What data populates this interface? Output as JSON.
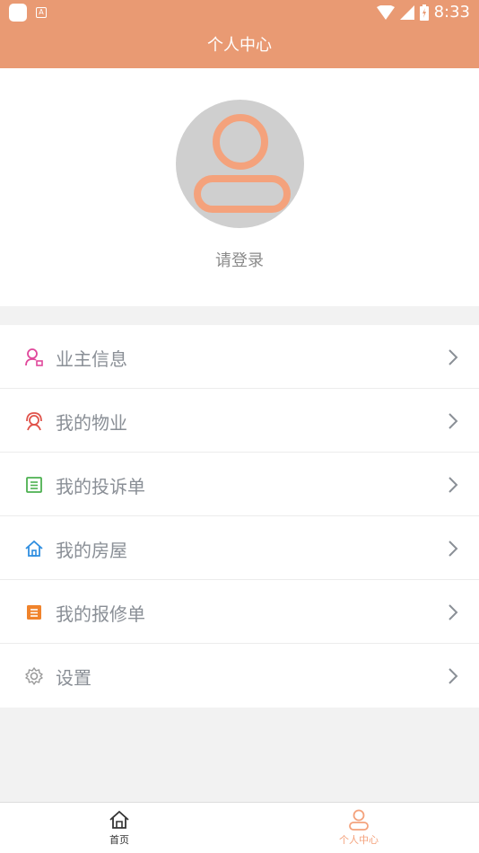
{
  "status_bar": {
    "time": "8:33"
  },
  "header": {
    "title": "个人中心"
  },
  "profile": {
    "login_text": "请登录"
  },
  "menu": {
    "items": [
      {
        "label": "业主信息",
        "icon": "owner-info-icon",
        "color": "#e0479b"
      },
      {
        "label": "我的物业",
        "icon": "property-service-icon",
        "color": "#e0524a"
      },
      {
        "label": "我的投诉单",
        "icon": "complaint-form-icon",
        "color": "#4cb050"
      },
      {
        "label": "我的房屋",
        "icon": "house-icon",
        "color": "#2f8ee0"
      },
      {
        "label": "我的报修单",
        "icon": "repair-form-icon",
        "color": "#f0832c"
      },
      {
        "label": "设置",
        "icon": "gear-icon",
        "color": "#9a9a9a"
      }
    ]
  },
  "tabbar": {
    "tabs": [
      {
        "label": "首页",
        "icon": "home-icon",
        "active": false
      },
      {
        "label": "个人中心",
        "icon": "person-icon",
        "active": true
      }
    ]
  },
  "colors": {
    "accent": "#e99a73",
    "tab_active": "#f4a27c",
    "tab_inactive": "#333333",
    "avatar_bg": "#cfcfcf"
  }
}
